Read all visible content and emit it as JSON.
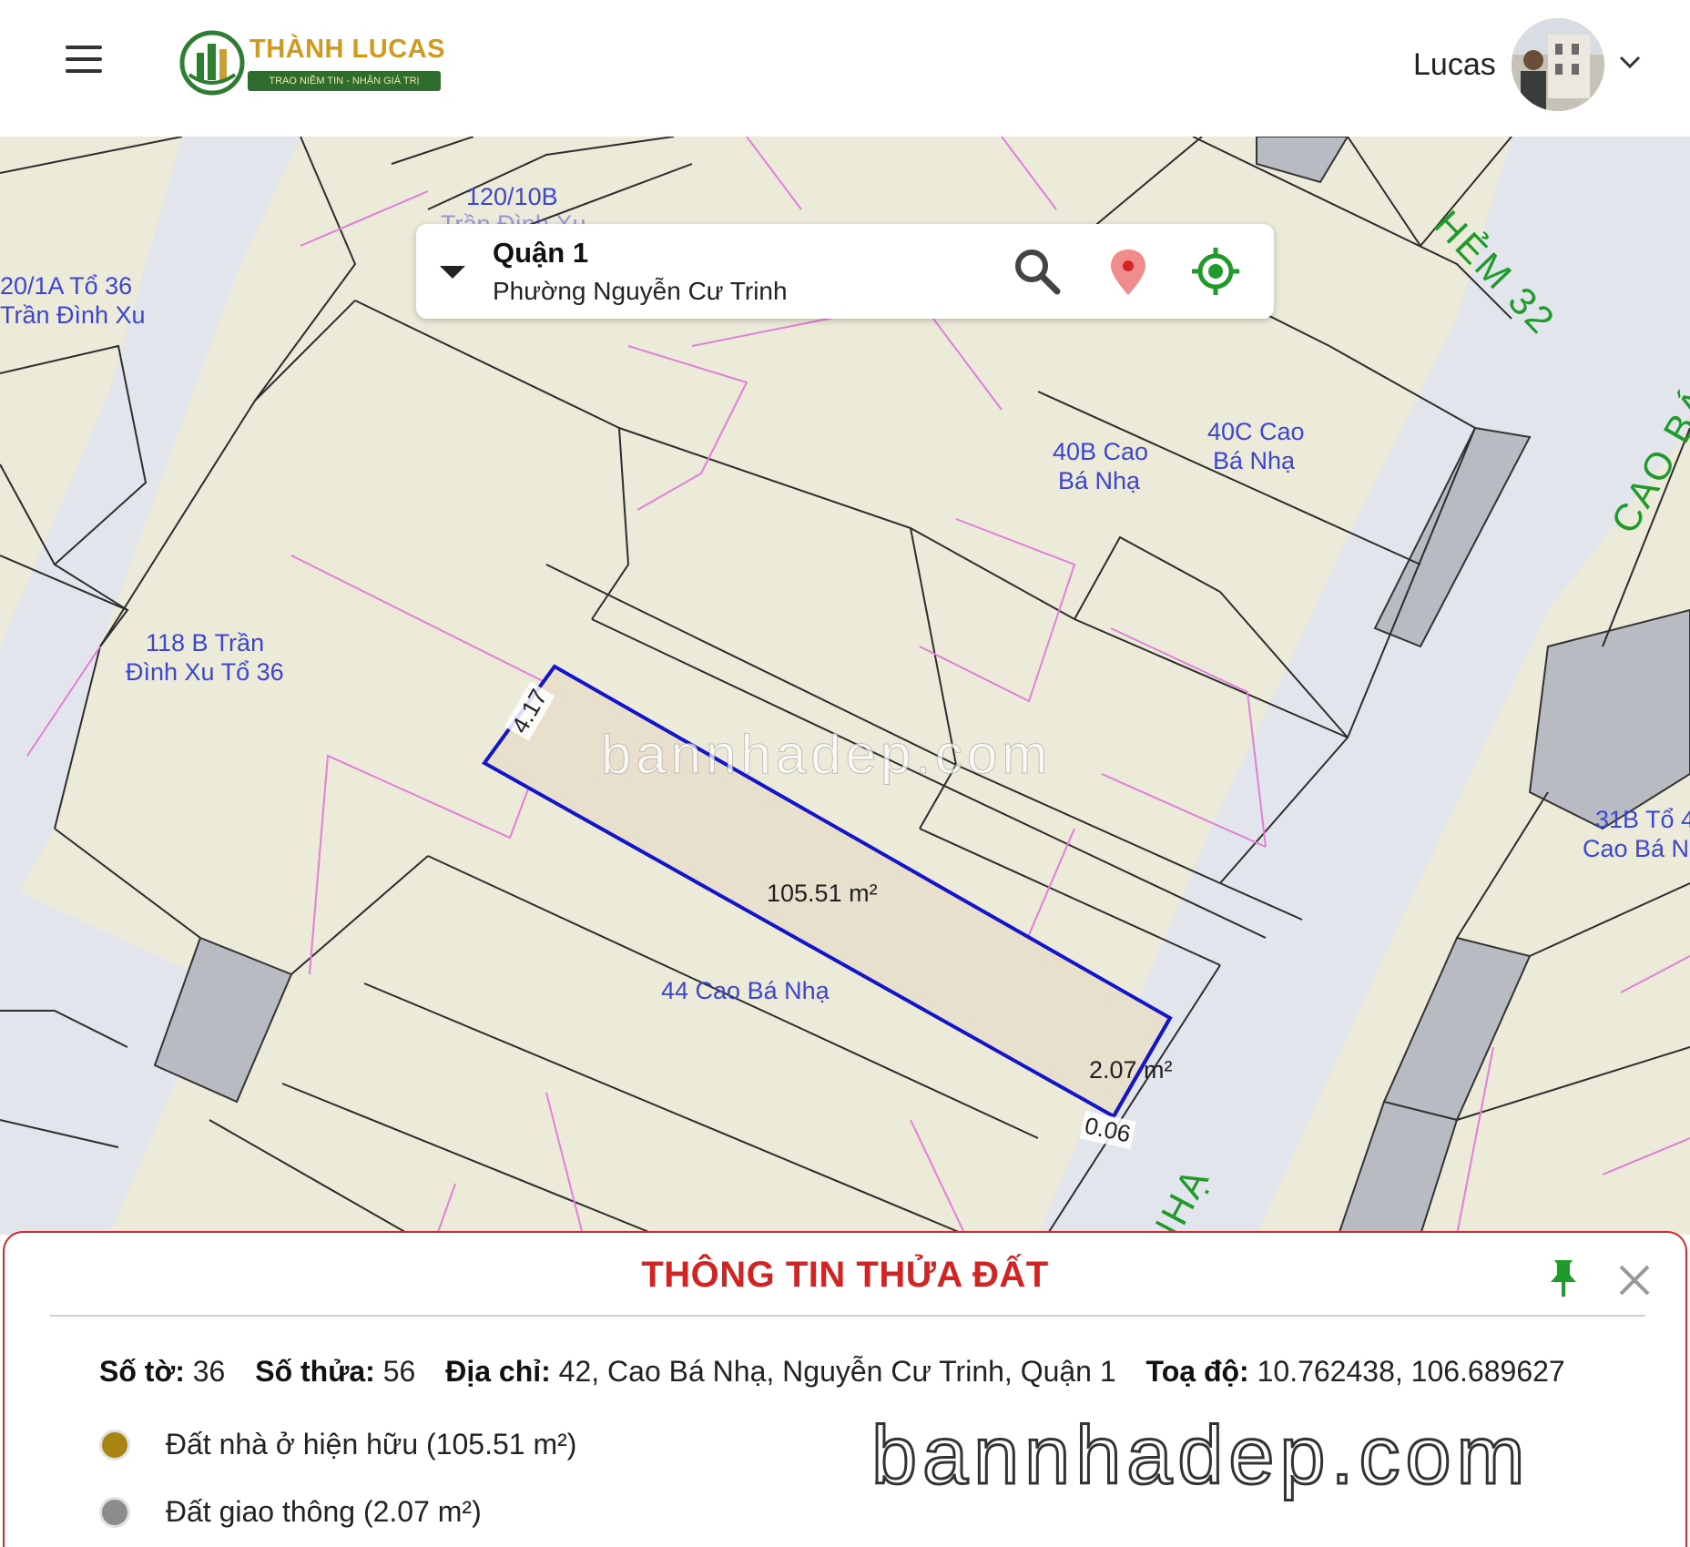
{
  "header": {
    "logo_title": "THÀNH LUCAS",
    "logo_tagline": "TRAO NIỀM TIN - NHẬN GIÁ TRỊ",
    "user_name": "Lucas"
  },
  "search": {
    "district": "Quận 1",
    "ward": "Phường Nguyễn Cư Trinh"
  },
  "map": {
    "labels": [
      "120/10B",
      "Trần Đình Xu",
      "20/1A Tổ 36",
      "Trần Đình Xu",
      "118 B Trần",
      "Đình Xu Tổ 36",
      "40B Cao",
      "Bá Nhạ",
      "40C Cao",
      "Bá Nhạ",
      "44 Cao Bá Nhạ",
      "31B Tổ 4",
      "Cao Bá N"
    ],
    "roads": [
      "HẺM 32",
      "CAO BÁ N",
      "NHẠ"
    ],
    "dimensions": {
      "width": "4.17",
      "front": "0.06"
    },
    "areas": {
      "main": "105.51 m²",
      "road": "2.07 m²"
    },
    "watermark": "bannhadep.com"
  },
  "panel": {
    "title": "THÔNG TIN THỬA ĐẤT",
    "so_to_label": "Số tờ:",
    "so_to": "36",
    "so_thua_label": "Số thửa:",
    "so_thua": "56",
    "dia_chi_label": "Địa chỉ:",
    "dia_chi": "42, Cao Bá Nhạ, Nguyễn Cư Trinh, Quận 1",
    "toa_do_label": "Toạ độ:",
    "toa_do": "10.762438, 106.689627",
    "legend": [
      {
        "text": "Đất nhà ở hiện hữu (105.51 m²)",
        "color": "#a88512"
      },
      {
        "text": "Đất giao thông (2.07 m²)",
        "color": "#8c8c8c"
      }
    ],
    "watermark": "bannhadep.com"
  },
  "colors": {
    "accent_red": "#d32424",
    "parcel_outline": "#1414c8",
    "label_blue": "#3c46d2",
    "road_green": "#1f9a2b"
  }
}
